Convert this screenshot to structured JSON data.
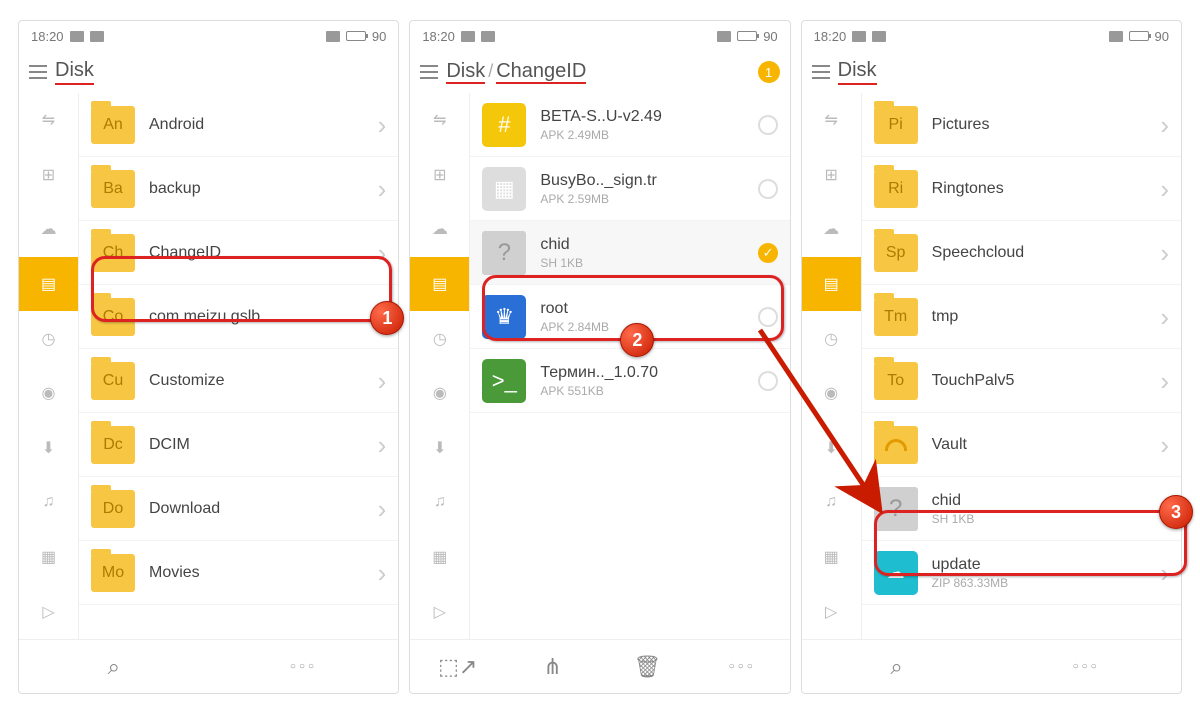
{
  "statusbar": {
    "time": "18:20",
    "battery": "90"
  },
  "screen1": {
    "path": "Disk",
    "items": [
      {
        "abbr": "An",
        "name": "Android"
      },
      {
        "abbr": "Ba",
        "name": "backup"
      },
      {
        "abbr": "Ch",
        "name": "ChangeID"
      },
      {
        "abbr": "Co",
        "name": "com.meizu.gslb"
      },
      {
        "abbr": "Cu",
        "name": "Customize"
      },
      {
        "abbr": "Dc",
        "name": "DCIM"
      },
      {
        "abbr": "Do",
        "name": "Download"
      },
      {
        "abbr": "Mo",
        "name": "Movies"
      }
    ]
  },
  "screen2": {
    "path1": "Disk",
    "path2": "ChangeID",
    "sel_count": "1",
    "items": [
      {
        "icon": "supersu",
        "name": "BETA-S..U-v2.49",
        "sub": "APK 2.49MB"
      },
      {
        "icon": "busybox",
        "name": "BusyBo.._sign.tr",
        "sub": "APK 2.59MB"
      },
      {
        "icon": "file",
        "name": "chid",
        "sub": "SH 1KB",
        "selected": true
      },
      {
        "icon": "root",
        "name": "root",
        "sub": "APK 2.84MB"
      },
      {
        "icon": "term",
        "name": "Термин.._1.0.70",
        "sub": "APK 551KB"
      }
    ]
  },
  "screen3": {
    "path": "Disk",
    "items": [
      {
        "type": "folder",
        "abbr": "Pi",
        "name": "Pictures"
      },
      {
        "type": "folder",
        "abbr": "Ri",
        "name": "Ringtones"
      },
      {
        "type": "folder",
        "abbr": "Sp",
        "name": "Speechcloud"
      },
      {
        "type": "folder",
        "abbr": "Tm",
        "name": "tmp"
      },
      {
        "type": "folder",
        "abbr": "To",
        "name": "TouchPalv5"
      },
      {
        "type": "vault",
        "name": "Vault"
      },
      {
        "type": "file",
        "name": "chid",
        "sub": "SH 1KB"
      },
      {
        "type": "zip",
        "name": "update",
        "sub": "ZIP 863.33MB"
      }
    ]
  },
  "callouts": {
    "c1": "1",
    "c2": "2",
    "c3": "3"
  },
  "icons": {
    "search": "⌕",
    "more": "○○○",
    "share": "<",
    "delete": "🗑",
    "select": "▧",
    "usb": "⇋",
    "net": "⊞",
    "cloud": "☁",
    "storage": "▤",
    "clock": "◷",
    "cam": "◉",
    "down": "⬇",
    "music": "♫",
    "image": "▦",
    "video": "▷"
  }
}
